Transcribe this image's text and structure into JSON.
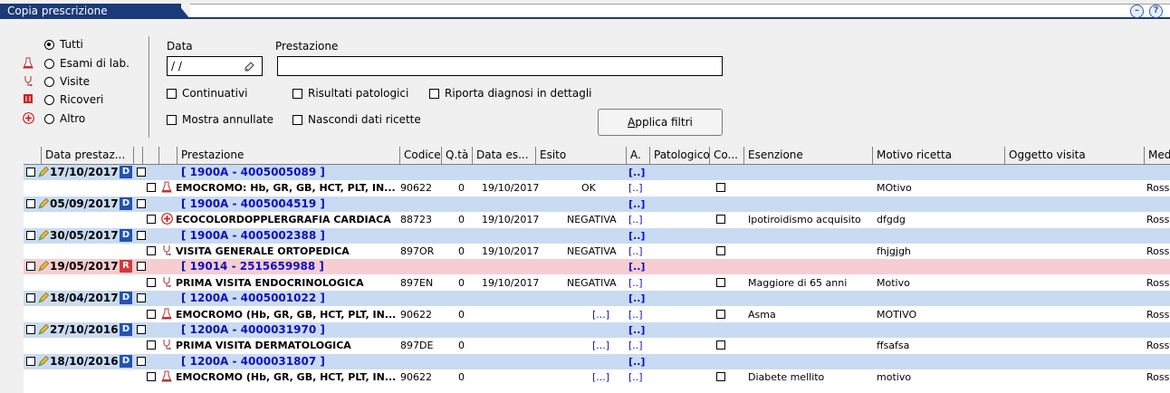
{
  "window": {
    "title": "Copia prescrizione"
  },
  "filters": {
    "radio_options": [
      {
        "label": "Tutti",
        "checked": true,
        "icon": ""
      },
      {
        "label": "Esami di lab.",
        "checked": false,
        "icon": "flask-icon"
      },
      {
        "label": "Visite",
        "checked": false,
        "icon": "stethoscope-icon"
      },
      {
        "label": "Ricoveri",
        "checked": false,
        "icon": "hospital-icon"
      },
      {
        "label": "Altro",
        "checked": false,
        "icon": "plus-circle-icon"
      }
    ],
    "date_label": "Data",
    "date_value": "/ /",
    "prestazione_label": "Prestazione",
    "prestazione_value": "",
    "checkboxes": {
      "continuativi": "Continuativi",
      "risultati_patologici": "Risultati patologici",
      "riporta_diagnosi": "Riporta diagnosi in dettagli",
      "mostra_annullate": "Mostra annullate",
      "nascondi_dati": "Nascondi dati ricette"
    },
    "apply_button": "Applica filtri",
    "apply_button_accel": "A",
    "apply_button_rest": "pplica filtri"
  },
  "grid": {
    "columns": [
      "Data prestaz...",
      "Prestazione",
      "Codice",
      "Q.tà",
      "Data es...",
      "Esito",
      "A.",
      "Patologico",
      "Co...",
      "Esenzione",
      "Motivo ricetta",
      "Oggetto visita",
      "Medi"
    ],
    "rows": [
      {
        "kind": "group",
        "date": "17/10/2017",
        "badge": "D",
        "text": "[ 1900A - 4005005089 ]",
        "a": "[..]"
      },
      {
        "kind": "detail",
        "icon": "flask-icon",
        "prestazione": "EMOCROMO: Hb, GR, GB, HCT, PLT, IN...",
        "codice": "90622",
        "qta": "0",
        "data_es": "19/10/2017",
        "esito": "OK",
        "a": "[..]",
        "esenzione": "",
        "motivo": "MOtivo",
        "oggetto": "",
        "medico": "Rossi"
      },
      {
        "kind": "group",
        "date": "05/09/2017",
        "badge": "D",
        "text": "[ 1900A - 4005004519 ]",
        "a": "[..]"
      },
      {
        "kind": "detail",
        "icon": "plus-circle-icon",
        "prestazione": "ECOCOLORDOPPLERGRAFIA CARDIACA",
        "codice": "88723",
        "qta": "0",
        "data_es": "19/10/2017",
        "esito": "NEGATIVA",
        "a": "[..]",
        "esenzione": "Ipotiroidismo acquisito",
        "motivo": "dfgdg",
        "oggetto": "",
        "medico": "Rossi"
      },
      {
        "kind": "group",
        "date": "30/05/2017",
        "badge": "D",
        "text": "[ 1900A - 4005002388 ]",
        "a": "[..]"
      },
      {
        "kind": "detail",
        "icon": "stethoscope-icon",
        "prestazione": "VISITA GENERALE ORTOPEDICA",
        "codice": "897OR",
        "qta": "0",
        "data_es": "19/10/2017",
        "esito": "NEGATIVA",
        "a": "[..]",
        "esenzione": "",
        "motivo": "fhjgjgh",
        "oggetto": "",
        "medico": "Rossi"
      },
      {
        "kind": "group",
        "date": "19/05/2017",
        "badge": "R",
        "red": true,
        "text": "[ 19014 - 2515659988 ]",
        "a": "[..]"
      },
      {
        "kind": "detail",
        "icon": "stethoscope-icon",
        "prestazione": "PRIMA VISITA ENDOCRINOLOGICA",
        "codice": "897EN",
        "qta": "0",
        "data_es": "19/10/2017",
        "esito": "NEGATIVA",
        "a": "[..]",
        "esenzione": "Maggiore di 65 anni",
        "motivo": "Motivo",
        "oggetto": "",
        "medico": "Rossi"
      },
      {
        "kind": "group",
        "date": "18/04/2017",
        "badge": "D",
        "text": "[ 1200A - 4005001022 ]",
        "a": "[..]"
      },
      {
        "kind": "detail",
        "icon": "flask-icon",
        "prestazione": "EMOCROMO (Hb, GR, GB, HCT, PLT, IN...",
        "codice": "90622",
        "qta": "0",
        "data_es": "",
        "esito": "[...]",
        "a": "[..]",
        "esenzione": "Asma",
        "motivo": "MOTIVO",
        "oggetto": "",
        "medico": "Rossi"
      },
      {
        "kind": "group",
        "date": "27/10/2016",
        "badge": "D",
        "text": "[ 1200A - 4000031970 ]",
        "a": "[..]"
      },
      {
        "kind": "detail",
        "icon": "stethoscope-icon",
        "prestazione": "PRIMA VISITA DERMATOLOGICA",
        "codice": "897DE",
        "qta": "0",
        "data_es": "",
        "esito": "[...]",
        "a": "[..]",
        "esenzione": "",
        "motivo": "ffsafsa",
        "oggetto": "",
        "medico": "Rossi"
      },
      {
        "kind": "group",
        "date": "18/10/2016",
        "badge": "D",
        "text": "[ 1200A - 4000031807 ]",
        "a": "[..]"
      },
      {
        "kind": "detail",
        "icon": "flask-icon",
        "prestazione": "EMOCROMO (Hb, GR, GB, HCT, PLT, IN...",
        "codice": "90622",
        "qta": "0",
        "data_es": "",
        "esito": "[...]",
        "a": "[..]",
        "esenzione": "Diabete mellito",
        "motivo": "motivo",
        "oggetto": "",
        "medico": "Rossi"
      }
    ]
  },
  "colors": {
    "title_bg": "#1a3a78",
    "group_row": "#c9dbf2",
    "group_row_red": "#f6cdd0",
    "badge_d": "#2352b5",
    "badge_r": "#d23a3a",
    "link": "#1010c0"
  }
}
